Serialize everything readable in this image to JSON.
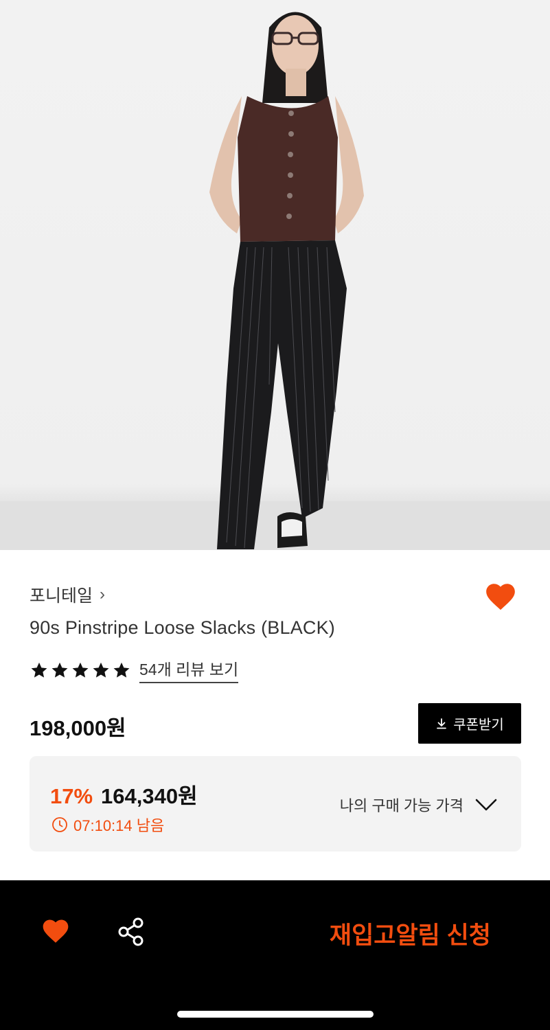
{
  "product": {
    "brand": "포니테일",
    "brand_chevron": "›",
    "title": "90s Pinstripe Loose Slacks (BLACK)",
    "rating_stars": 5,
    "review_link": "54개 리뷰 보기",
    "price": "198,000원",
    "coupon_button": "쿠폰받기"
  },
  "discount": {
    "rate": "17%",
    "price": "164,340원",
    "timer": "07:10:14 남음",
    "my_price_label": "나의 구매 가능 가격"
  },
  "bottom_bar": {
    "restock_button": "재입고알림 신청"
  },
  "colors": {
    "accent": "#f24d0f",
    "coupon_bg": "#000000",
    "price_box_bg": "#f3f3f3",
    "bottom_bar_bg": "#000000"
  },
  "icons": {
    "wishlist": "heart-icon",
    "chevron": "chevron-right-icon",
    "star": "star-icon",
    "download": "download-icon",
    "clock": "clock-icon",
    "expand": "chevron-down-icon",
    "share": "share-icon"
  }
}
